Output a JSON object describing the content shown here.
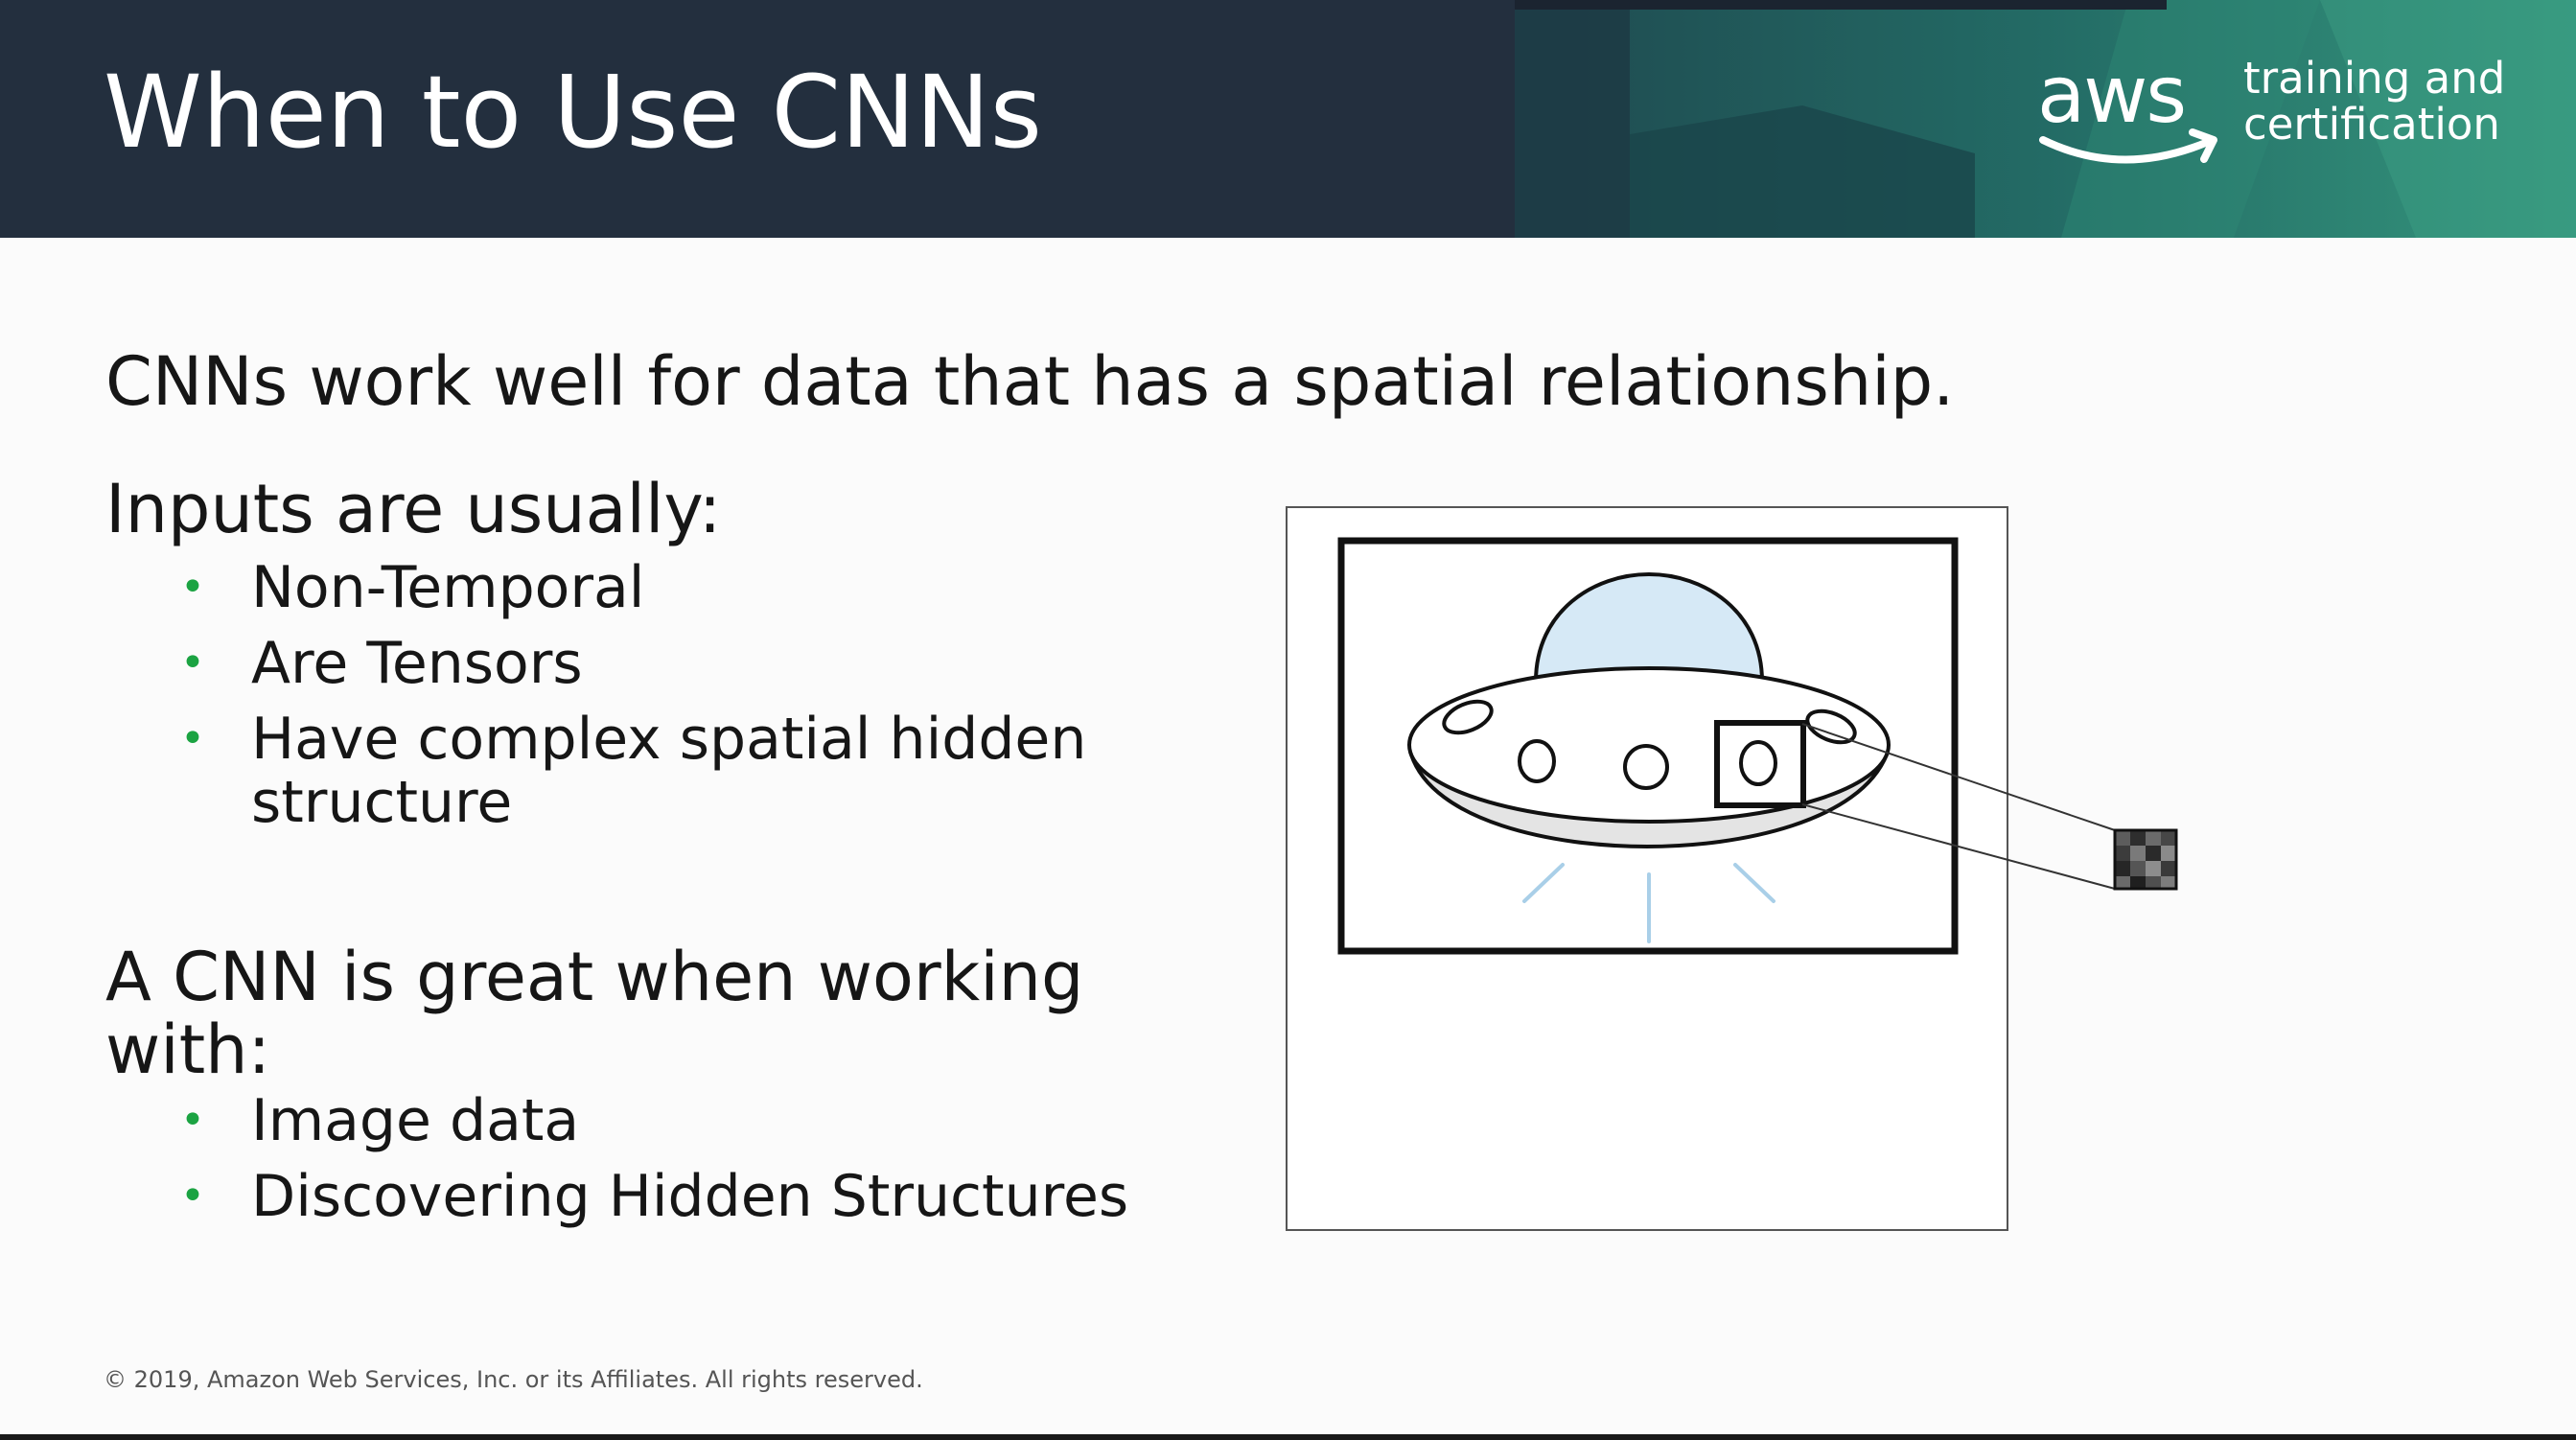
{
  "header": {
    "title": "When to Use CNNs",
    "brand": {
      "logo_text": "aws",
      "tagline_line1": "training and",
      "tagline_line2": "certification"
    }
  },
  "body": {
    "lead": "CNNs work well for data that has a spatial relationship.",
    "sections": [
      {
        "heading": "Inputs are usually:",
        "bullets": [
          "Non-Temporal",
          "Are Tensors",
          "Have complex spatial hidden structure"
        ]
      },
      {
        "heading": "A CNN is great when working with:",
        "bullets": [
          "Image data",
          "Discovering Hidden Structures"
        ]
      }
    ]
  },
  "footer": {
    "copyright": "© 2019, Amazon Web Services, Inc. or its Affiliates. All rights reserved."
  },
  "colors": {
    "header_bg": "#232f3e",
    "accent_teal": "#2e8f78",
    "bullet_green": "#1ba342",
    "dome_fill": "#d6e9f6"
  },
  "icons": {
    "bullet": "•",
    "illustration": "ufo-icon",
    "feature_patch": "pixel-patch-icon"
  }
}
